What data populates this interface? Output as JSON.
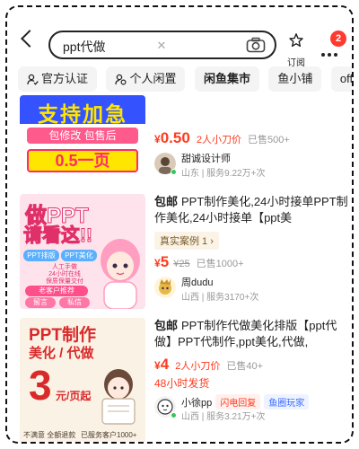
{
  "search": {
    "query": "ppt代做"
  },
  "header": {
    "subscribe_label": "订阅",
    "notification_count": "2"
  },
  "filters": [
    {
      "label": "官方认证",
      "icon": "verified-user-icon"
    },
    {
      "label": "个人闲置",
      "icon": "idle-user-icon"
    },
    {
      "label": "闲鱼集市",
      "icon": null
    },
    {
      "label": "鱼小铺",
      "icon": null
    },
    {
      "label": "office办",
      "icon": null
    }
  ],
  "listings": [
    {
      "thumb": {
        "line1": "支持加急",
        "line2": "包修改 包售后",
        "line3": "0.5一页"
      },
      "price_symbol": "¥",
      "price": "0.50",
      "want": "2人小刀价",
      "sold": "已售500+",
      "seller": "甜诚设计师",
      "location": "山东",
      "service": "服务9.22万+次"
    },
    {
      "thumb": {
        "line1": "做PPT",
        "line2": "请看这!!",
        "tag1": "PPT排版",
        "tag2": "PPT美化",
        "note": "人工手做\n24小时在线\n保质保量交付",
        "banner": "老客户推荐",
        "btn1": "留言",
        "btn2": "私信"
      },
      "ship_tag": "包邮",
      "title": "PPT制作美化,24小时接单PPT制作美化,24小时接单【ppt美",
      "case_label": "真实案例 1",
      "price_symbol": "¥",
      "price": "5",
      "old_price": "¥25",
      "sold": "已售1000+",
      "seller": "周dudu",
      "location": "山西",
      "service": "服务3170+次"
    },
    {
      "thumb": {
        "line1": "PPT制作",
        "line2": "美化 / 代做",
        "big": "3",
        "unit": "元/页起",
        "foot1": "不满意 全额退款",
        "foot2": "已服务客户1000+"
      },
      "ship_tag": "包邮",
      "title": "PPT制作代做美化排版【ppt代做】PPT代制作,ppt美化,代做,",
      "price_symbol": "¥",
      "price": "4",
      "want": "2人小刀价",
      "sold": "已售40+",
      "ship_time": "48小时发货",
      "seller": "小徐pp",
      "badge1": "闪电回复",
      "badge2": "鱼圈玩家",
      "location": "山西",
      "service": "服务3.21万+次"
    }
  ],
  "colors": {
    "accent": "#ff3b1f",
    "badge": "#ff3b30",
    "online": "#34c759"
  }
}
